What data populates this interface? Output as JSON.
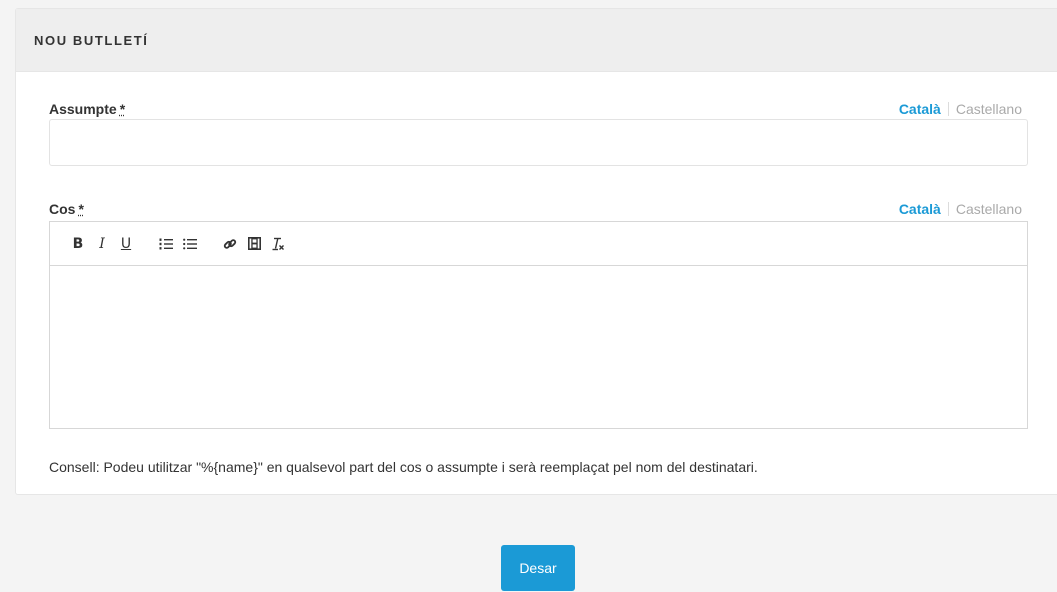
{
  "panel": {
    "title": "NOU BUTLLETÍ"
  },
  "subject": {
    "label": "Assumpte",
    "required_mark": "*",
    "value": "",
    "lang_active": "Català",
    "lang_inactive": "Castellano"
  },
  "body": {
    "label": "Cos",
    "required_mark": "*",
    "lang_active": "Català",
    "lang_inactive": "Castellano",
    "toolbar": {
      "bold": "B",
      "italic": "I",
      "underline": "U",
      "icons": [
        "bold-icon",
        "italic-icon",
        "underline-icon",
        "ordered-list-icon",
        "bullet-list-icon",
        "link-icon",
        "video-icon",
        "clear-format-icon"
      ]
    }
  },
  "hint": "Consell: Podeu utilitzar \"%{name}\" en qualsevol part del cos o assumpte i serà reemplaçat pel nom del destinatari.",
  "actions": {
    "save_label": "Desar"
  },
  "colors": {
    "accent": "#1b9ad6",
    "header_bg": "#eeeeee"
  }
}
